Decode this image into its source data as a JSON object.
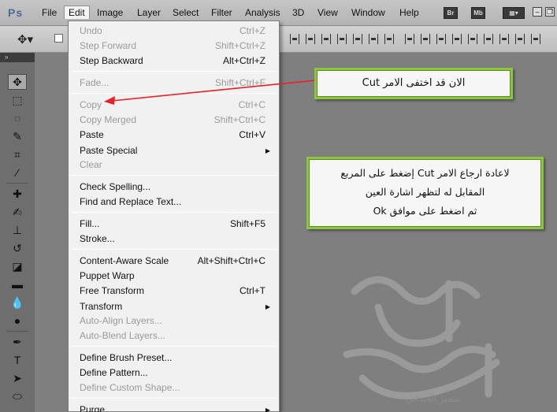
{
  "app": {
    "logo": "Ps"
  },
  "menubar": {
    "items": [
      "File",
      "Edit",
      "Image",
      "Layer",
      "Select",
      "Filter",
      "Analysis",
      "3D",
      "View",
      "Window",
      "Help"
    ],
    "bridge_btn": "Br",
    "minibridge_btn": "Mb"
  },
  "edit_menu": {
    "items": [
      {
        "label": "Undo",
        "shortcut": "Ctrl+Z",
        "disabled": true
      },
      {
        "label": "Step Forward",
        "shortcut": "Shift+Ctrl+Z",
        "disabled": true
      },
      {
        "label": "Step Backward",
        "shortcut": "Alt+Ctrl+Z",
        "disabled": false
      },
      {
        "label": "Fade...",
        "shortcut": "Shift+Ctrl+F",
        "disabled": true
      },
      {
        "label": "Copy",
        "shortcut": "Ctrl+C",
        "disabled": true
      },
      {
        "label": "Copy Merged",
        "shortcut": "Shift+Ctrl+C",
        "disabled": true
      },
      {
        "label": "Paste",
        "shortcut": "Ctrl+V",
        "disabled": false
      },
      {
        "label": "Paste Special",
        "shortcut": "",
        "disabled": false,
        "submenu": true
      },
      {
        "label": "Clear",
        "shortcut": "",
        "disabled": true
      },
      {
        "label": "Check Spelling...",
        "shortcut": "",
        "disabled": false
      },
      {
        "label": "Find and Replace Text...",
        "shortcut": "",
        "disabled": false
      },
      {
        "label": "Fill...",
        "shortcut": "Shift+F5",
        "disabled": false
      },
      {
        "label": "Stroke...",
        "shortcut": "",
        "disabled": false
      },
      {
        "label": "Content-Aware Scale",
        "shortcut": "Alt+Shift+Ctrl+C",
        "disabled": false
      },
      {
        "label": "Puppet Warp",
        "shortcut": "",
        "disabled": false
      },
      {
        "label": "Free Transform",
        "shortcut": "Ctrl+T",
        "disabled": false
      },
      {
        "label": "Transform",
        "shortcut": "",
        "disabled": false,
        "submenu": true
      },
      {
        "label": "Auto-Align Layers...",
        "shortcut": "",
        "disabled": true
      },
      {
        "label": "Auto-Blend Layers...",
        "shortcut": "",
        "disabled": true
      },
      {
        "label": "Define Brush Preset...",
        "shortcut": "",
        "disabled": false
      },
      {
        "label": "Define Pattern...",
        "shortcut": "",
        "disabled": false
      },
      {
        "label": "Define Custom Shape...",
        "shortcut": "",
        "disabled": true
      },
      {
        "label": "Purge",
        "shortcut": "",
        "disabled": false,
        "submenu": true
      }
    ]
  },
  "callouts": {
    "note1": "الان قد اختفى الامر Cut",
    "note2_line1": "لاعادة ارجاع الامر Cut إضغط على المربع",
    "note2_line2": "المقابل له لتظهر اشارة العين",
    "note2_line3": "ثم اضغط على موافق Ok"
  },
  "watermark": {
    "text": "سمير العيداني"
  },
  "colors": {
    "callout_border": "#8cc63f",
    "arrow": "#e8202a"
  }
}
